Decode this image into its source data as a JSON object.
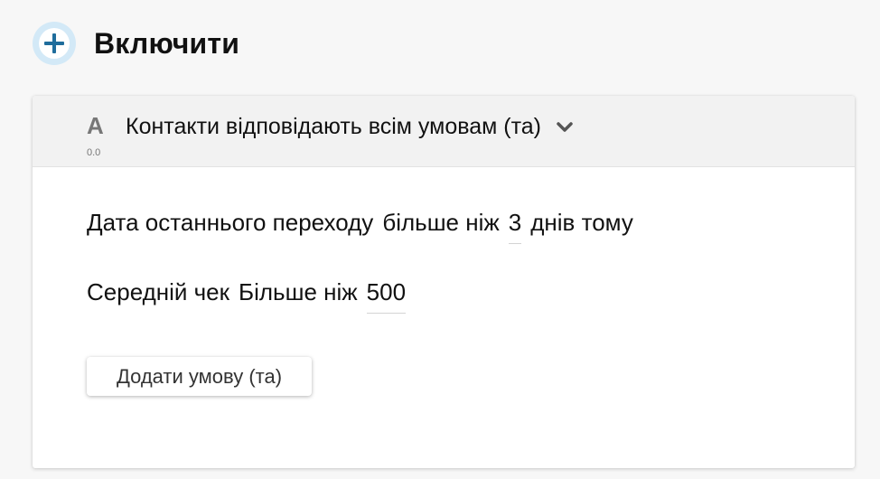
{
  "header": {
    "title": "Включити",
    "icon": "plus-circle-icon",
    "accent_color": "#1f6d9c"
  },
  "group": {
    "letter": "A",
    "index": "0.0",
    "label": "Контакти відповідають всім умовам (та)",
    "dropdown_icon": "chevron-down-icon"
  },
  "conditions": [
    {
      "field": "Дата останнього переходу",
      "operator": "більше ніж",
      "value": "3",
      "suffix": "днів тому"
    },
    {
      "field": "Середній чек",
      "operator": "Більше ніж",
      "value": "500"
    }
  ],
  "add_condition_label": "Додати умову (та)"
}
